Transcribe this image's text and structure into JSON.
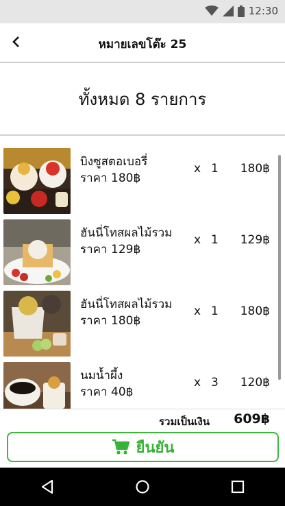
{
  "status_bar": {
    "time": "12:30",
    "icons": [
      "wifi-icon",
      "cell-signal-icon",
      "battery-icon"
    ]
  },
  "header": {
    "back_icon": "chevron-left-icon",
    "title": "หมายเลขโต๊ะ 25"
  },
  "summary": {
    "text": "ทั้งหมด 8 รายการ"
  },
  "items": [
    {
      "name": "บิงซูสตอเบอรี่",
      "price": "ราคา 180฿",
      "x": "x",
      "qty": "1",
      "total": "180฿"
    },
    {
      "name": "ฮันนี่โทสผลไม้รวม",
      "price": "ราคา 129฿",
      "x": "x",
      "qty": "1",
      "total": "129฿"
    },
    {
      "name": "ฮันนี่โทสผลไม้รวม",
      "price": "ราคา 180฿",
      "x": "x",
      "qty": "1",
      "total": "180฿"
    },
    {
      "name": "นมน้ำผึ้ง",
      "price": "ราคา 40฿",
      "x": "x",
      "qty": "3",
      "total": "120฿"
    }
  ],
  "footer": {
    "total_label": "รวมเป็นเงิน",
    "total_value": "609฿",
    "confirm_label": "ยืนยัน",
    "confirm_icon": "shopping-cart-icon",
    "accent_color": "#36b236"
  },
  "nav": {
    "icons": [
      "back-triangle-icon",
      "home-circle-icon",
      "recents-square-icon"
    ]
  }
}
